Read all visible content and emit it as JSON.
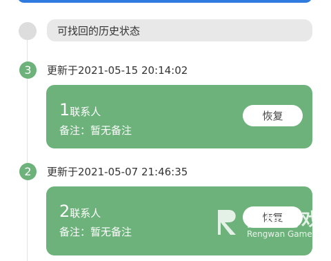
{
  "history_label": "可找回的历史状态",
  "entries": [
    {
      "index": "3",
      "updated": "更新于2021-05-15 20:14:02",
      "count": "1",
      "count_unit": "联系人",
      "note": "备注：暂无备注",
      "restore_label": "恢复"
    },
    {
      "index": "2",
      "updated": "更新于2021-05-07 21:46:35",
      "count": "2",
      "count_unit": "联系人",
      "note": "备注：暂无备注",
      "restore_label": "恢复"
    }
  ],
  "watermark": {
    "cn": "仍玩游戏",
    "en": "Rengwan Games"
  },
  "colors": {
    "accent_green": "#6cb27a",
    "top_bar_blue": "#2f7be0",
    "pill_grey": "#e8e8e8"
  }
}
